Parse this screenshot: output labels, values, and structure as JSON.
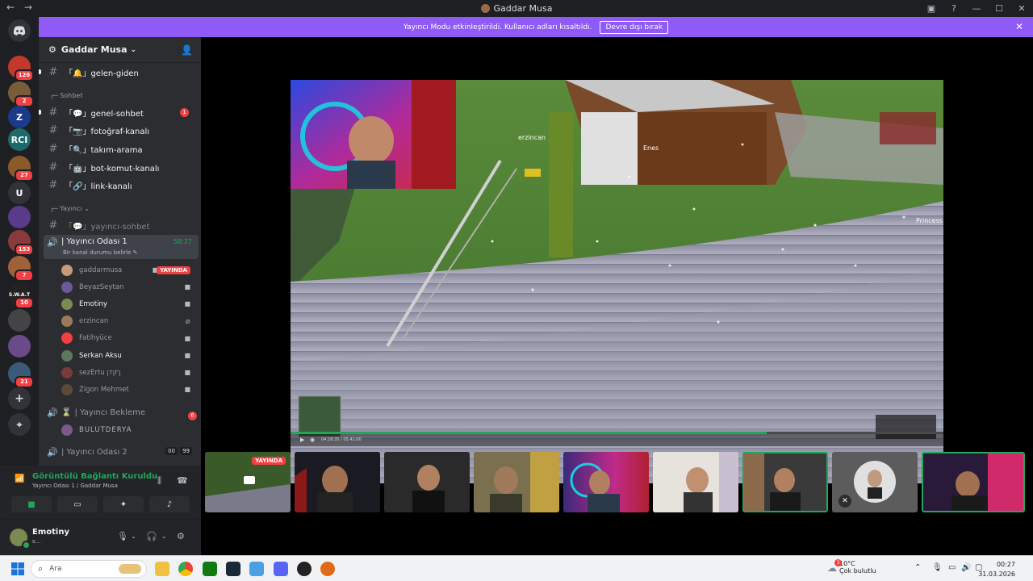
{
  "window": {
    "title": "Gaddar Musa",
    "back": "←",
    "forward": "→"
  },
  "banner": {
    "text": "Yayıncı Modu etkinleştirildi. Kullanıcı adları kısaltıldı.",
    "button": "Devre dışı bırak",
    "close": "✕"
  },
  "guilds": [
    {
      "label": "",
      "badge": "126",
      "color": "#c0392b"
    },
    {
      "label": "",
      "badge": "2",
      "color": "#7a5c3a"
    },
    {
      "label": "Z",
      "badge": "",
      "color": "#1b3a8a"
    },
    {
      "label": "RCI",
      "badge": "",
      "color": "#1d6a6a"
    },
    {
      "label": "",
      "badge": "27",
      "color": "#8a5a2a"
    },
    {
      "label": "U",
      "badge": "",
      "color": "#313338"
    },
    {
      "label": "",
      "badge": "",
      "color": "#5a3a8a"
    },
    {
      "label": "",
      "badge": "153",
      "color": "#8a3a3a"
    },
    {
      "label": "",
      "badge": "7",
      "color": "#a0603a"
    },
    {
      "label": "S.W.A.T",
      "badge": "10",
      "color": "#222"
    },
    {
      "label": "",
      "badge": "",
      "color": "#444"
    },
    {
      "label": "",
      "badge": "",
      "color": "#6a4a8a"
    },
    {
      "label": "",
      "badge": "21",
      "color": "#3a5a7a"
    }
  ],
  "guild_actions": {
    "add": "+",
    "discover": "⌖"
  },
  "server": {
    "name": "Gaddar Musa",
    "chevron": "⌄"
  },
  "channels": {
    "top": {
      "name": "「🔔」gelen-giden"
    },
    "cat_sohbet": "Sohbet",
    "sohbet": [
      {
        "name": "「💬」genel-sohbet",
        "badge": "1"
      },
      {
        "name": "「📷」fotoğraf-kanalı",
        "badge": ""
      },
      {
        "name": "「🔍」takım-arama",
        "badge": ""
      },
      {
        "name": "「🤖」bot-komut-kanalı",
        "badge": ""
      },
      {
        "name": "「🔗」link-kanalı",
        "badge": ""
      }
    ],
    "cat_yayinci": "Yayıncı",
    "yayinci_text": "「💬」yayıncı-sohbet",
    "voice1": {
      "name": "| Yayıncı Odası 1",
      "time": "58:27",
      "status": "Bir kanal durumu belirle"
    },
    "voice_users": [
      {
        "name": "gaddarmusa",
        "live": "YAYINDA",
        "bright": false,
        "color": "#c89a7a"
      },
      {
        "name": "BeyazSeytan",
        "live": "",
        "bright": false,
        "color": "#6a5a9a"
      },
      {
        "name": "Emotiny",
        "live": "",
        "bright": true,
        "color": "#7a8a50"
      },
      {
        "name": "erzincan",
        "live": "",
        "bright": false,
        "color": "#9a7a5a"
      },
      {
        "name": "Fatihyüce",
        "live": "",
        "bright": false,
        "color": "#f23f42"
      },
      {
        "name": "Serkan Aksu",
        "live": "",
        "bright": true,
        "color": "#5a7a5a"
      },
      {
        "name": "sezErtu ꞁᴛꞁᴦꞁ",
        "live": "",
        "bright": false,
        "color": "#7a3a3a"
      },
      {
        "name": "Zigon Mehmet",
        "live": "",
        "bright": false,
        "color": "#5a4a3a"
      }
    ],
    "voice2": {
      "name": "| Yayıncı Bekleme",
      "badge": "6"
    },
    "voice2_user": "BULUTDERYA",
    "voice3": {
      "name": "| Yayıncı Odası 2",
      "count_a": "00",
      "count_b": "99"
    }
  },
  "voice_panel": {
    "status": "Görüntülü Bağlantı Kuruldu",
    "location": "Yayıncı Odası 1 / Gaddar Musa"
  },
  "user_panel": {
    "name": "Emotiny",
    "status": "s..."
  },
  "stage": {
    "labels": {
      "player1": "erzincan",
      "player2": "Enes",
      "player3": "Princess"
    },
    "timecode": "04:28:35 / 05:41:00",
    "progress": 0.73
  },
  "tiles": [
    {
      "live": "YAYINDA"
    }
  ],
  "taskbar": {
    "search_placeholder": "Ara",
    "weather_badge": "3",
    "weather_temp": "10°C",
    "weather_desc": "Çok bulutlu",
    "time": "00:27",
    "date": "31.03.2026"
  }
}
